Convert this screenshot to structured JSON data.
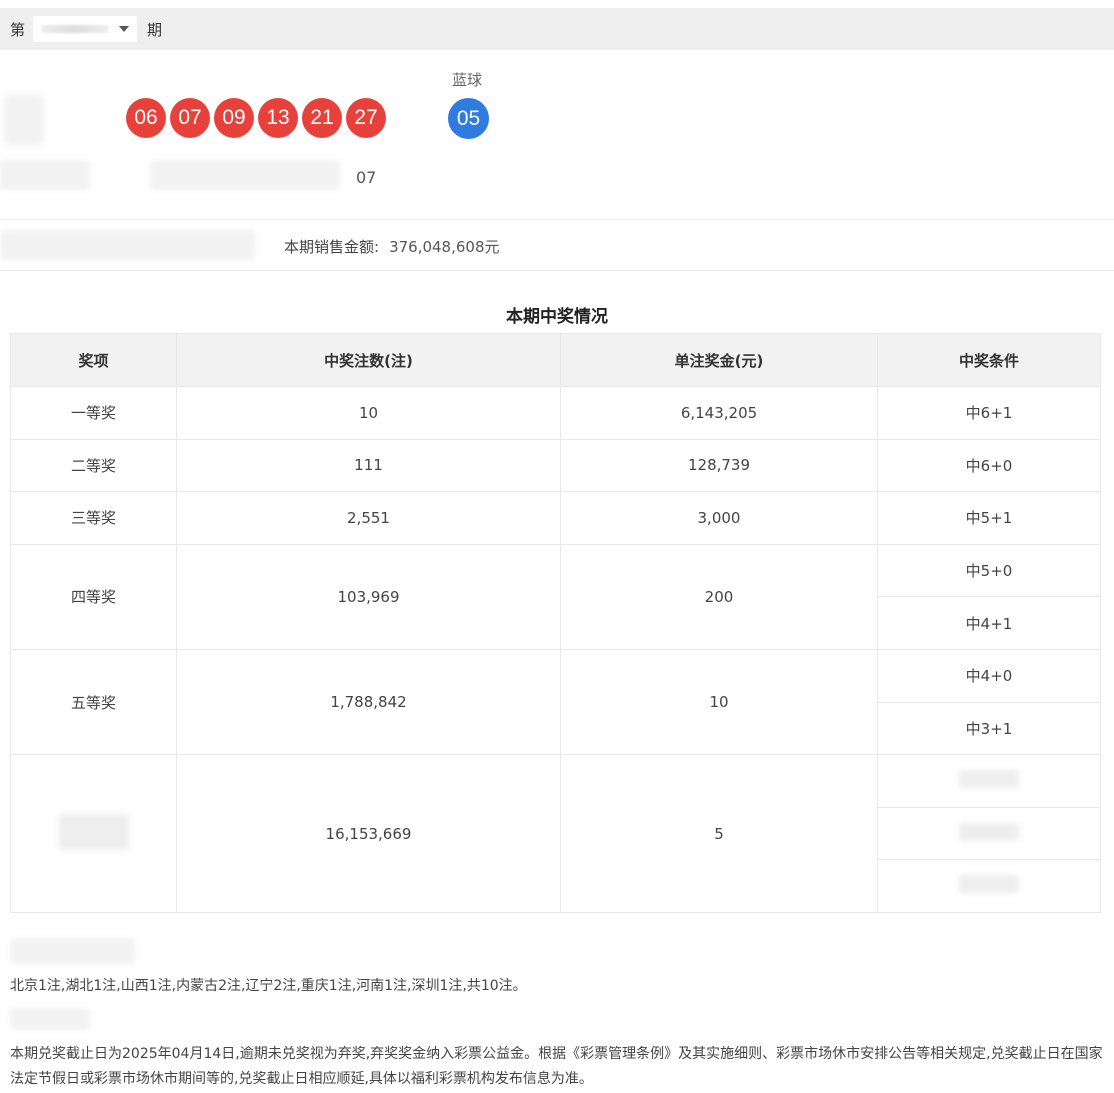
{
  "issue_bar": {
    "prefix": "第",
    "suffix": "期"
  },
  "draw": {
    "blue_label": "蓝球",
    "red_balls": [
      "06",
      "07",
      "09",
      "13",
      "21",
      "27"
    ],
    "blue_ball": "05",
    "extra_number": "07"
  },
  "sales": {
    "label": "本期销售金额:",
    "value": "376,048,608元"
  },
  "prize_section": {
    "title": "本期中奖情况",
    "headers": [
      "奖项",
      "中奖注数(注)",
      "单注奖金(元)",
      "中奖条件"
    ],
    "rows": [
      {
        "level": "一等奖",
        "count": "10",
        "amount": "6,143,205",
        "conditions": [
          "中6+1"
        ]
      },
      {
        "level": "二等奖",
        "count": "111",
        "amount": "128,739",
        "conditions": [
          "中6+0"
        ]
      },
      {
        "level": "三等奖",
        "count": "2,551",
        "amount": "3,000",
        "conditions": [
          "中5+1"
        ]
      },
      {
        "level": "四等奖",
        "count": "103,969",
        "amount": "200",
        "conditions": [
          "中5+0",
          "中4+1"
        ]
      },
      {
        "level": "五等奖",
        "count": "1,788,842",
        "amount": "10",
        "conditions": [
          "中4+0",
          "中3+1"
        ]
      },
      {
        "level": "",
        "count": "16,153,669",
        "amount": "5",
        "conditions": [
          "",
          "",
          ""
        ]
      }
    ]
  },
  "notes": {
    "region_distribution": "北京1注,湖北1注,山西1注,内蒙古2注,辽宁2注,重庆1注,河南1注,深圳1注,共10注。",
    "deadline": "本期兑奖截止日为2025年04月14日,逾期未兑奖视为弃奖,弃奖奖金纳入彩票公益金。根据《彩票管理条例》及其实施细则、彩票市场休市安排公告等相关规定,兑奖截止日在国家法定节假日或彩票市场休市期间等的,兑奖截止日相应顺延,具体以福利彩票机构发布信息为准。"
  }
}
